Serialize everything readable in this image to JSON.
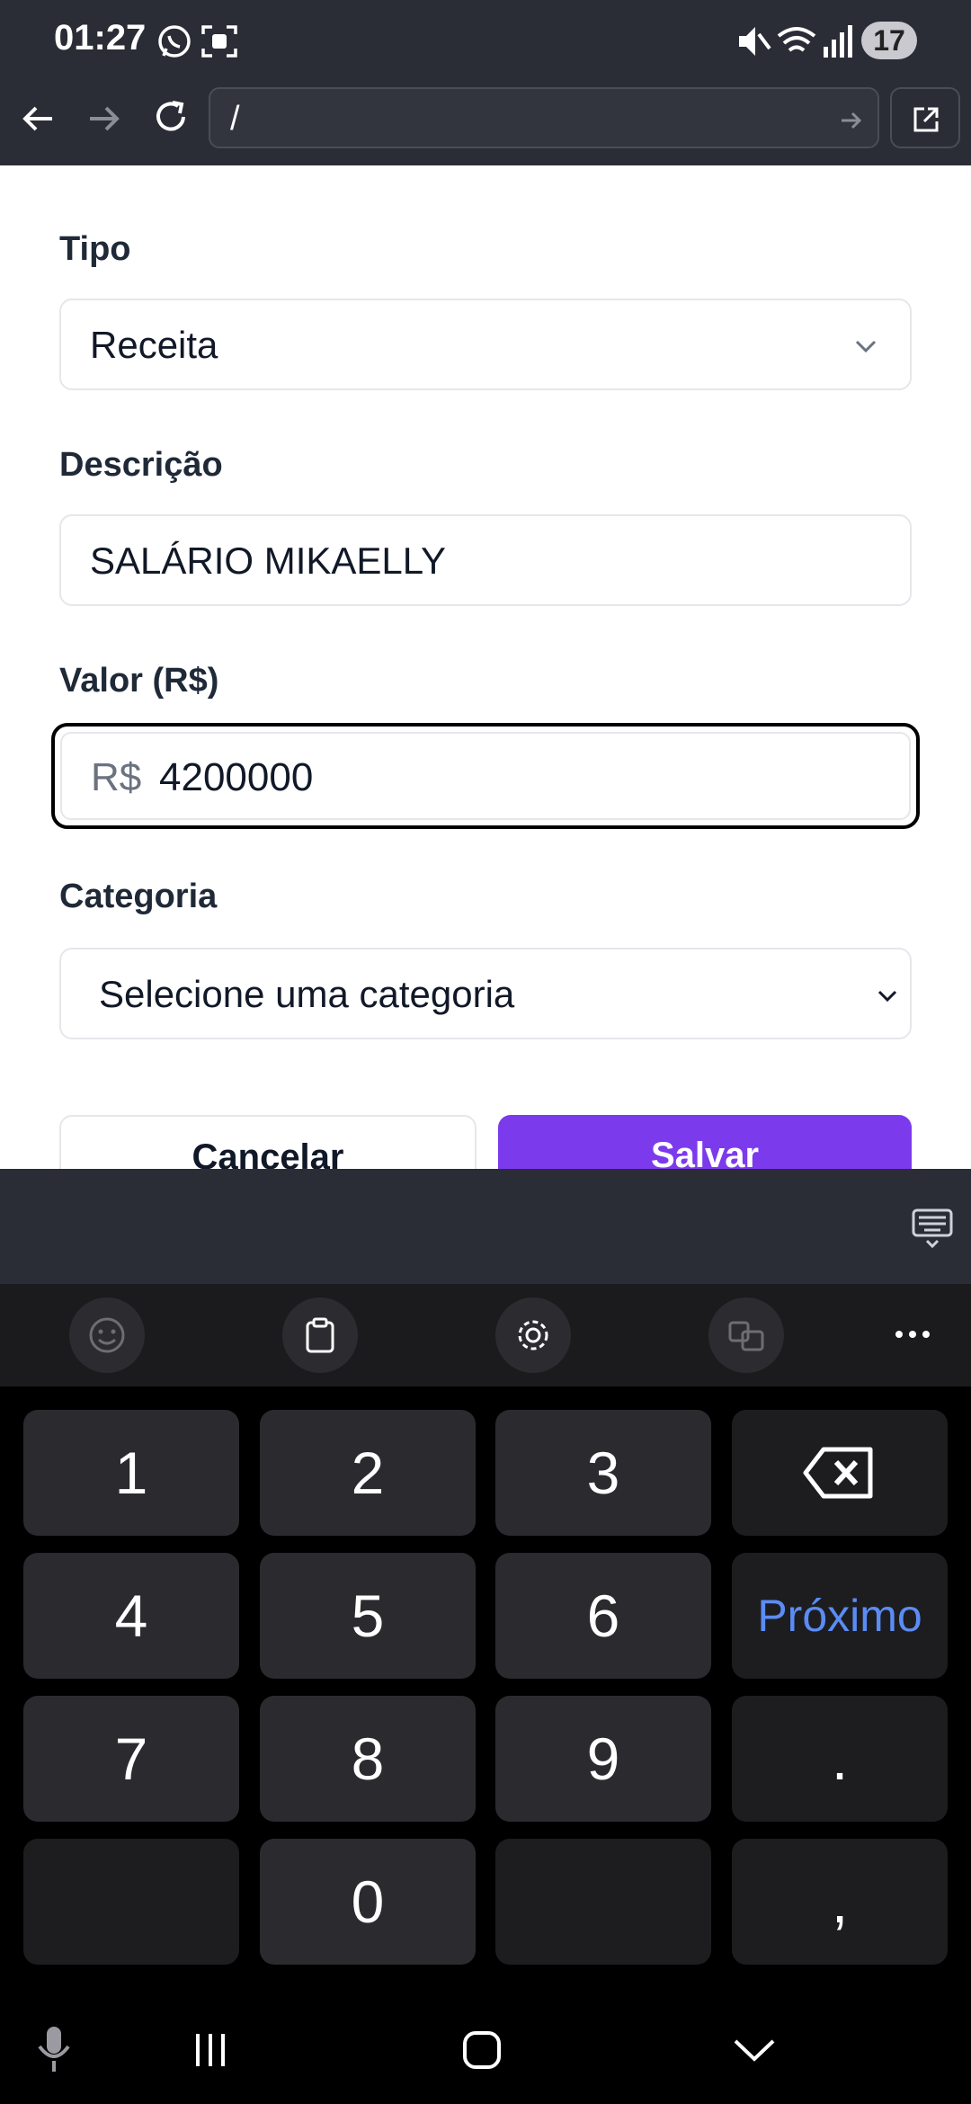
{
  "status_bar": {
    "time": "01:27",
    "battery": "17"
  },
  "browser": {
    "url": "/"
  },
  "form": {
    "tipo": {
      "label": "Tipo",
      "value": "Receita"
    },
    "descricao": {
      "label": "Descrição",
      "value": "SALÁRIO MIKAELLY"
    },
    "valor": {
      "label": "Valor (R$)",
      "prefix": "R$",
      "value": "4200000"
    },
    "categoria": {
      "label": "Categoria",
      "value": "Selecione uma categoria"
    },
    "cancel_label": "Cancelar",
    "save_label": "Salvar"
  },
  "keyboard": {
    "keys": [
      "1",
      "2",
      "3",
      "4",
      "5",
      "6",
      "7",
      "8",
      "9",
      "0"
    ],
    "next_label": "Próximo",
    "dot": ".",
    "comma": ","
  },
  "colors": {
    "accent": "#7c3aed",
    "next_text": "#5b8cf5"
  }
}
